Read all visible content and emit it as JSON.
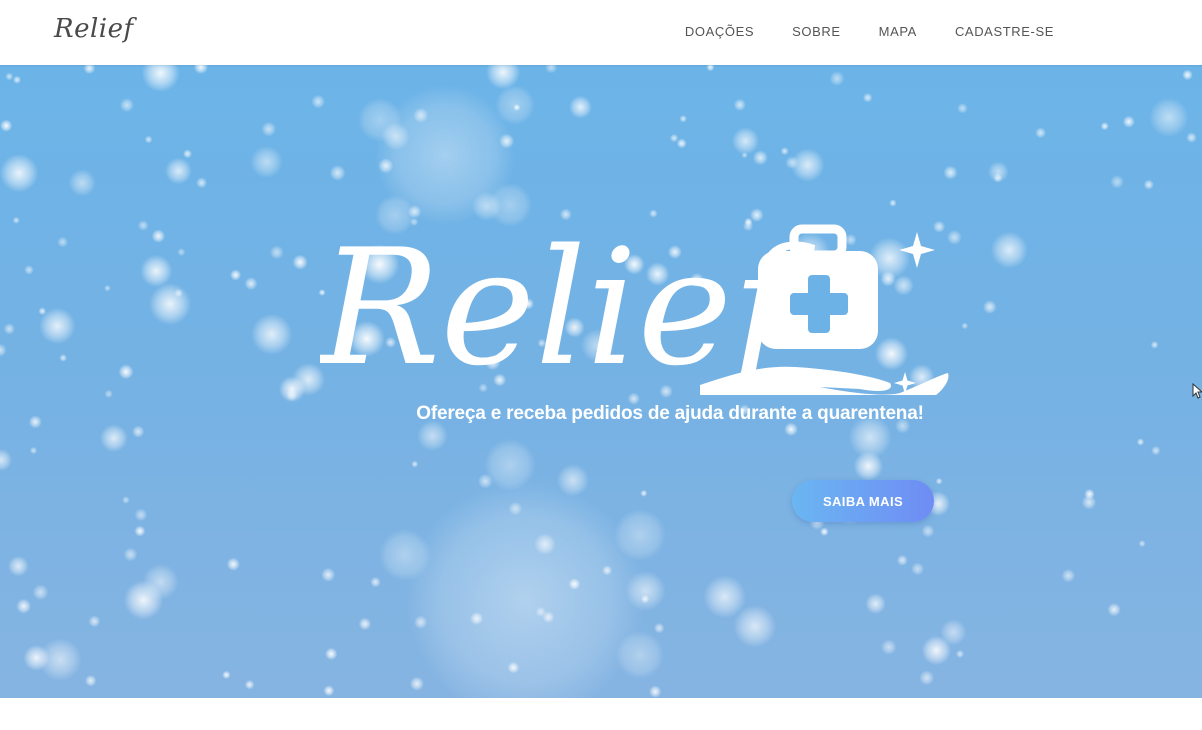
{
  "brand": {
    "name": "Relief"
  },
  "nav": {
    "items": [
      {
        "label": "DOAÇÕES"
      },
      {
        "label": "SOBRE"
      },
      {
        "label": "MAPA"
      },
      {
        "label": "CADASTRE-SE"
      }
    ]
  },
  "hero": {
    "logo_text": "Relief",
    "tagline": "Ofereça e receba pedidos de ajuda durante a quarentena!",
    "cta_label": "SAIBA MAIS",
    "logo_icons": [
      "medical-kit-icon",
      "hand-icon",
      "sparkle-icon"
    ]
  },
  "colors": {
    "hero_bg": "#6cb4e8",
    "cta_start": "#6ab6f2",
    "cta_end": "#6f8cf4",
    "text_white": "#ffffff",
    "nav_text": "#555555"
  }
}
